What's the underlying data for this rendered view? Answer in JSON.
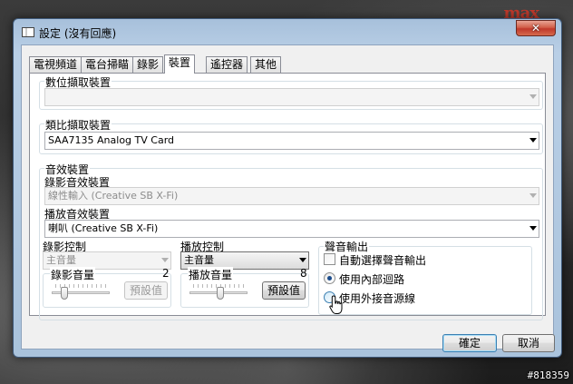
{
  "window": {
    "title": "設定 (沒有回應)",
    "close_glyph": "✕"
  },
  "tabs": [
    {
      "label": "電視頻道",
      "active": false
    },
    {
      "label": "電台掃瞄",
      "active": false
    },
    {
      "label": "錄影",
      "active": false
    },
    {
      "label": "裝置",
      "active": true
    },
    {
      "label": "遙控器",
      "active": false
    },
    {
      "label": "其他",
      "active": false
    }
  ],
  "digital_capture": {
    "label": "數位擷取裝置",
    "value": ""
  },
  "analog_capture": {
    "label": "類比擷取裝置",
    "value": "SAA7135 Analog TV Card"
  },
  "audio": {
    "label": "音效裝置",
    "record_label": "錄影音效裝置",
    "record_value": "線性輸入 (Creative SB X-Fi)",
    "playback_label": "播放音效裝置",
    "playback_value": "喇叭 (Creative SB X-Fi)",
    "record_control": {
      "label": "錄影控制",
      "source_value": "主音量",
      "volume_label": "錄影音量",
      "volume_value": "2",
      "default_button": "預設值"
    },
    "playback_control": {
      "label": "播放控制",
      "source_value": "主音量",
      "volume_label": "播放音量",
      "volume_value": "8",
      "default_button": "預設值"
    },
    "output": {
      "label": "聲音輸出",
      "auto_select": "自動選擇聲音輸出",
      "option_internal": "使用內部迴路",
      "option_external": "使用外接音源線",
      "selected": "internal"
    }
  },
  "buttons": {
    "ok": "確定",
    "cancel": "取消"
  },
  "background": {
    "logo": "max",
    "watermark": "#818359"
  }
}
